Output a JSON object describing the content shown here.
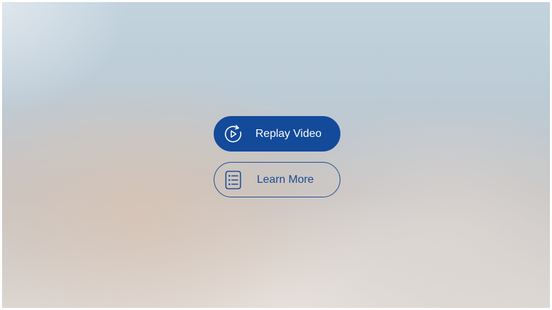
{
  "actions": {
    "replay": {
      "label": "Replay Video",
      "icon": "replay-icon",
      "background": "#134a9a",
      "text_color": "#ffffff"
    },
    "learn_more": {
      "label": "Learn More",
      "icon": "list-icon",
      "border_color": "#1d4d94",
      "text_color": "#1a4a90"
    }
  }
}
